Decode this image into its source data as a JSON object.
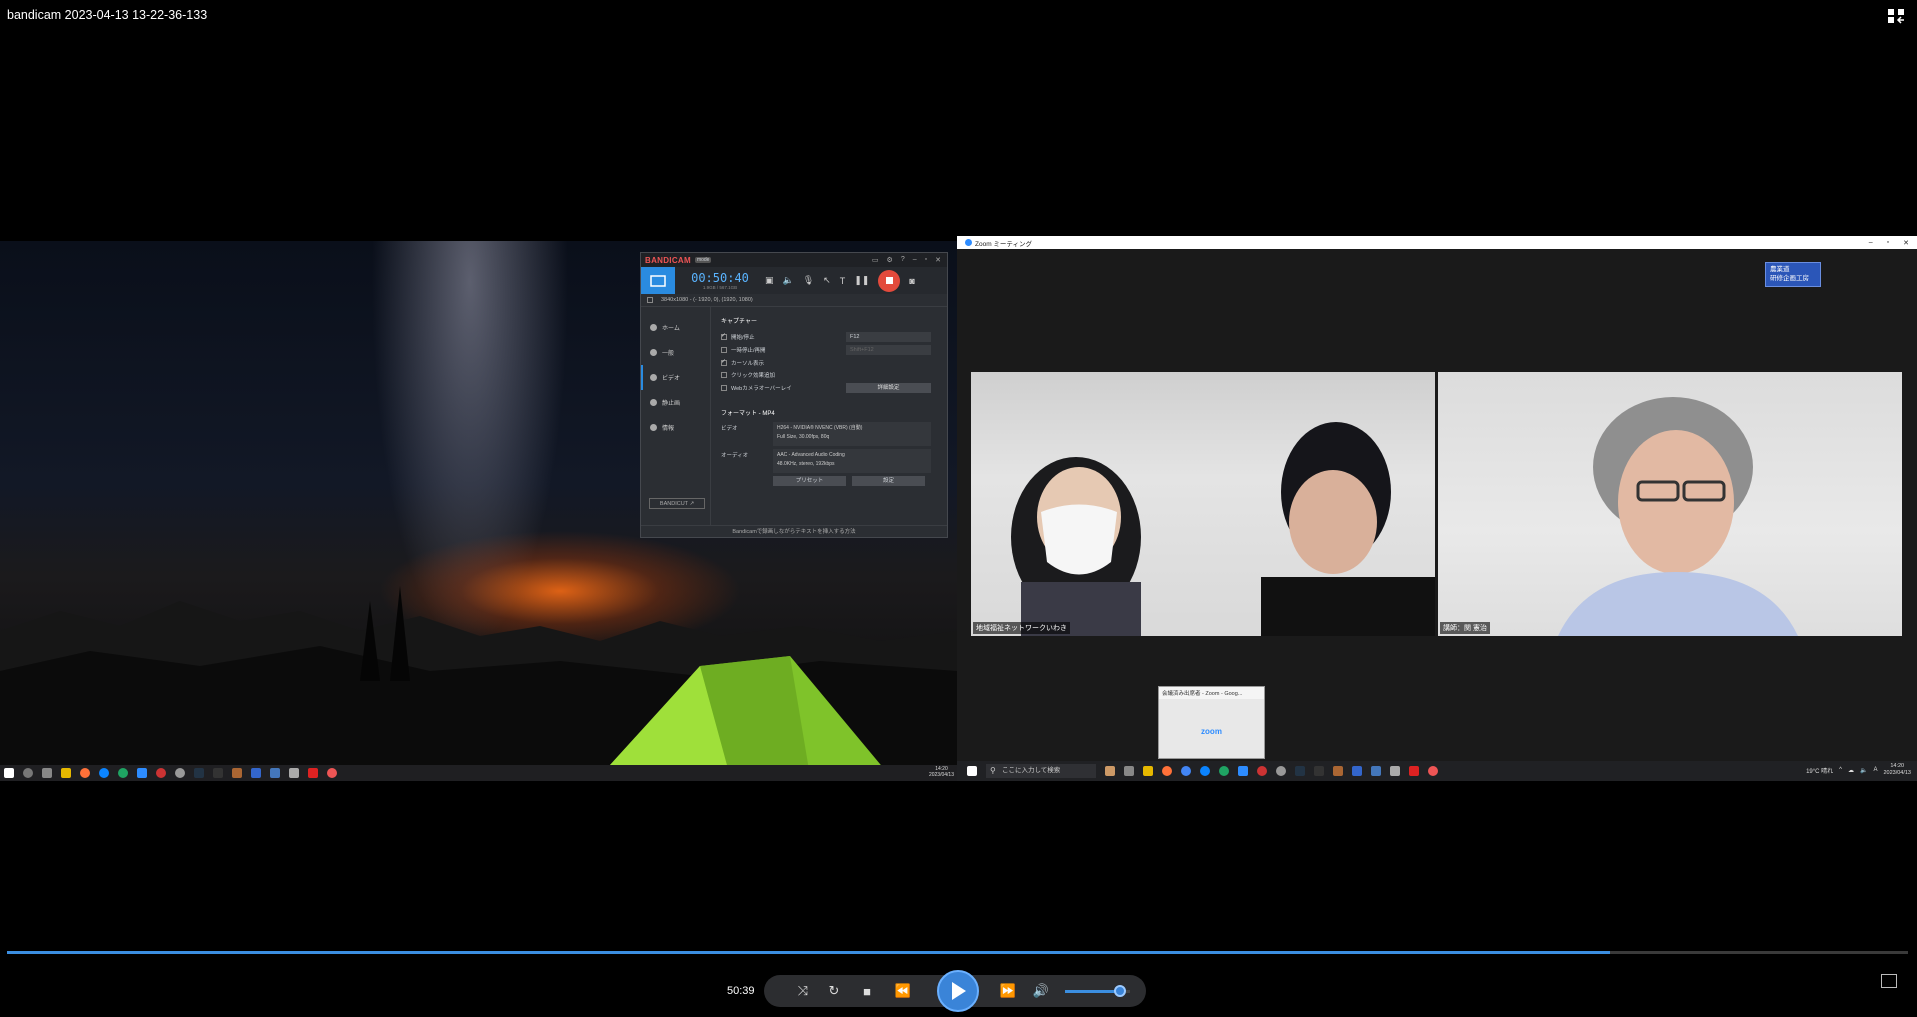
{
  "window": {
    "title": "bandicam 2023-04-13 13-22-36-133"
  },
  "bandicam": {
    "logo": "BANDICAM",
    "badge": "mode",
    "timer": "00:50:40",
    "size_info": "1.9GB / 567.1GB",
    "region": "3840x1080 - (- 1920, 0), (1920, 1080)",
    "sidebar": [
      "ホーム",
      "一般",
      "ビデオ",
      "静止画",
      "情報"
    ],
    "bandicut": "BANDICUT ↗",
    "capture_title": "キャプチャー",
    "options": [
      {
        "label": "開始/停止",
        "checked": true,
        "hotkey": "F12"
      },
      {
        "label": "一時停止/再開",
        "checked": false,
        "hotkey": "Shift+F12"
      },
      {
        "label": "カーソル表示",
        "checked": true
      },
      {
        "label": "クリック効果追加",
        "checked": false
      },
      {
        "label": "Webカメラオーバーレイ",
        "checked": false,
        "button": "詳細設定"
      }
    ],
    "format_title": "フォーマット - MP4",
    "video_label": "ビデオ",
    "video_line1": "H264 - NVIDIA® NVENC (VBR) (自動)",
    "video_line2": "Full Size, 30.00fps, 80q",
    "audio_label": "オーディオ",
    "audio_line1": "AAC - Advanced Audio Coding",
    "audio_line2": "48.0KHz, stereo, 192kbps",
    "preset_btn": "プリセット",
    "settings_btn": "設定",
    "footer": "Bandicamで録画しながらテキストを挿入する方法"
  },
  "zoom": {
    "title": "Zoom ミーティング",
    "badge_line1": "農業道",
    "badge_line2": "研修企画工房",
    "participants": [
      {
        "name": "地域福祉ネットワークいわき"
      },
      {
        "name": "講師：関 憲治"
      }
    ],
    "preview_title": "会議済み出席者 - Zoom - Goog...",
    "preview_logo": "zoom"
  },
  "taskbar": {
    "search_placeholder": "ここに入力して検索",
    "weather": "19°C 晴れ",
    "clock_time_left": "14:20",
    "clock_date_left": "2023/04/13",
    "clock_time_right": "14:20",
    "clock_date_right": "2023/04/13"
  },
  "player": {
    "current_time": "50:39",
    "progress_fraction": 0.843,
    "volume_fraction": 0.85
  },
  "colors": {
    "accent": "#3b8ee0",
    "record": "#e34a3c",
    "zoom_blue": "#2d8cff"
  }
}
